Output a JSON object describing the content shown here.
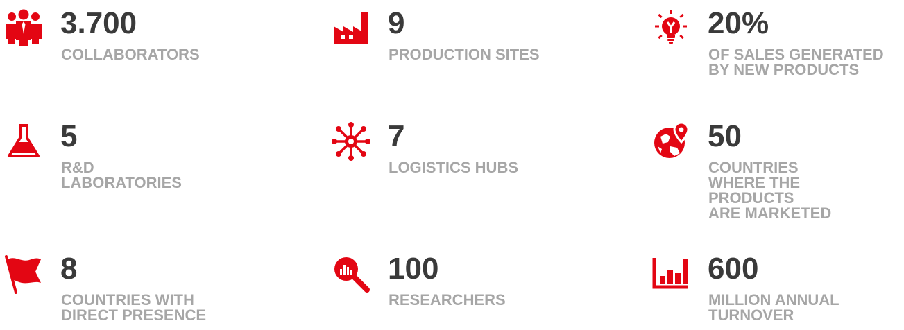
{
  "accent_color": "#e30613",
  "stats": [
    {
      "icon": "people-icon",
      "value": "3.700",
      "label": "COLLABORATORS"
    },
    {
      "icon": "factory-icon",
      "value": "9",
      "label": "PRODUCTION SITES"
    },
    {
      "icon": "lightbulb-icon",
      "value": "20%",
      "label": "OF SALES GENERATED\nBY NEW PRODUCTS"
    },
    {
      "icon": "flask-icon",
      "value": "5",
      "label": "R&D\nLABORATORIES"
    },
    {
      "icon": "network-hub-icon",
      "value": "7",
      "label": "LOGISTICS HUBS"
    },
    {
      "icon": "globe-pin-icon",
      "value": "50",
      "label": "COUNTRIES\nWHERE THE PRODUCTS\nARE MARKETED"
    },
    {
      "icon": "flag-icon",
      "value": "8",
      "label": "COUNTRIES WITH\nDIRECT PRESENCE"
    },
    {
      "icon": "magnifier-chart-icon",
      "value": "100",
      "label": "RESEARCHERS"
    },
    {
      "icon": "bar-chart-icon",
      "value": "600",
      "label": "MILLION ANNUAL\nTURNOVER"
    }
  ]
}
